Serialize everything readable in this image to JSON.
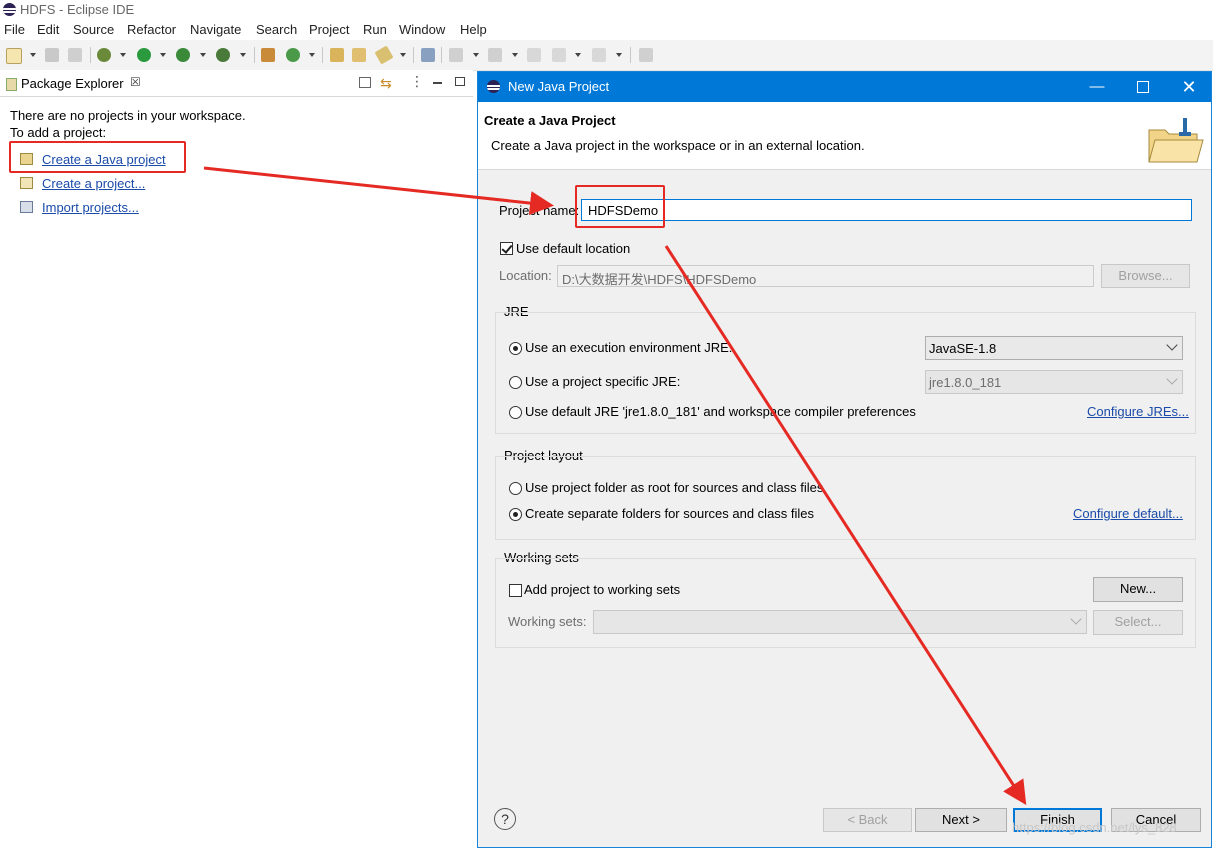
{
  "window": {
    "title": "HDFS - Eclipse IDE"
  },
  "menu": [
    "File",
    "Edit",
    "Source",
    "Refactor",
    "Navigate",
    "Search",
    "Project",
    "Run",
    "Window",
    "Help"
  ],
  "package_explorer": {
    "tab_label": "Package Explorer",
    "tab_close": "☒",
    "empty_msg": "There are no projects in your workspace.",
    "add_msg": "To add a project:",
    "links": [
      "Create a Java project",
      "Create a project...",
      "Import projects..."
    ]
  },
  "dialog": {
    "title": "New Java Project",
    "header_title": "Create a Java Project",
    "header_desc": "Create a Java project in the workspace or in an external location.",
    "project_name_label": "Project name:",
    "project_name_value": "HDFSDemo",
    "use_default_location_label": "Use default location",
    "use_default_location_checked": true,
    "location_label": "Location:",
    "location_value": "D:\\大数据开发\\HDFS\\HDFSDemo",
    "browse_label": "Browse...",
    "jre": {
      "group_label": "JRE",
      "options": [
        "Use an execution environment JRE:",
        "Use a project specific JRE:",
        "Use default JRE 'jre1.8.0_181' and workspace compiler preferences"
      ],
      "selected": 0,
      "execution_env": "JavaSE-1.8",
      "specific_jre": "jre1.8.0_181",
      "configure_link": "Configure JREs..."
    },
    "layout": {
      "group_label": "Project layout",
      "options": [
        "Use project folder as root for sources and class files",
        "Create separate folders for sources and class files"
      ],
      "selected": 1,
      "configure_link": "Configure default..."
    },
    "working_sets": {
      "group_label": "Working sets",
      "add_label": "Add project to working sets",
      "add_checked": false,
      "new_button": "New...",
      "sets_label": "Working sets:",
      "select_button": "Select..."
    },
    "buttons": {
      "help": "?",
      "back": "< Back",
      "next": "Next >",
      "finish": "Finish",
      "cancel": "Cancel"
    }
  },
  "watermark": "https://blog.csdn.net/lys_828",
  "colors": {
    "title_bar": "#0078d7",
    "annotation": "#e52a24",
    "link": "#1a4ba8"
  }
}
